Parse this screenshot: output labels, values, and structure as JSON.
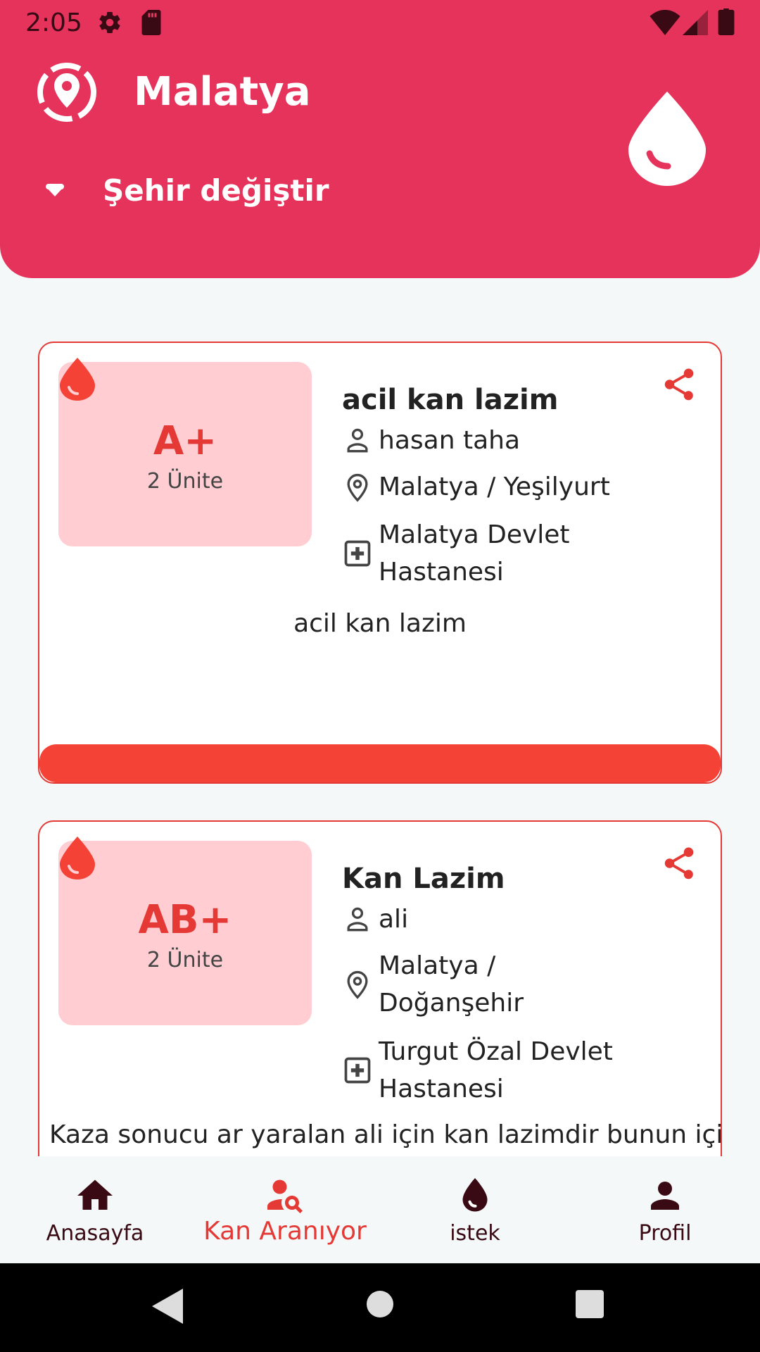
{
  "status_bar": {
    "time": "2:05"
  },
  "header": {
    "city": "Malatya",
    "change_city_label": "Şehir değiştir"
  },
  "requests": [
    {
      "blood_type": "A+",
      "units": "2 Ünite",
      "title": "acil kan lazim",
      "person": "hasan taha",
      "location_line1": "Malatya / Yeşilyurt",
      "hospital_line1": "Malatya Devlet",
      "hospital_line2": "Hastanesi",
      "description": "acil kan lazim"
    },
    {
      "blood_type": "AB+",
      "units": "2 Ünite",
      "title": "Kan Lazim",
      "person": "ali",
      "location_line1": "Malatya /",
      "location_line2": "Doğanşehir",
      "hospital_line1": "Turgut Özal Devlet",
      "hospital_line2": "Hastanesi",
      "description": "Kaza sonucu ar yaralan ali için kan lazimdir bunun için"
    }
  ],
  "bottom_nav": {
    "items": [
      {
        "label": "Anasayfa",
        "icon": "home-icon"
      },
      {
        "label": "Kan Aranıyor",
        "icon": "person-search-icon",
        "active": true
      },
      {
        "label": "istek",
        "icon": "blood-drop-icon"
      },
      {
        "label": "Profil",
        "icon": "person-icon"
      }
    ]
  },
  "colors": {
    "header": "#e6335c",
    "accent": "#e53935",
    "bar": "#f44336",
    "blood_box": "#ffcdd2",
    "nav_text": "#3a0a14"
  }
}
